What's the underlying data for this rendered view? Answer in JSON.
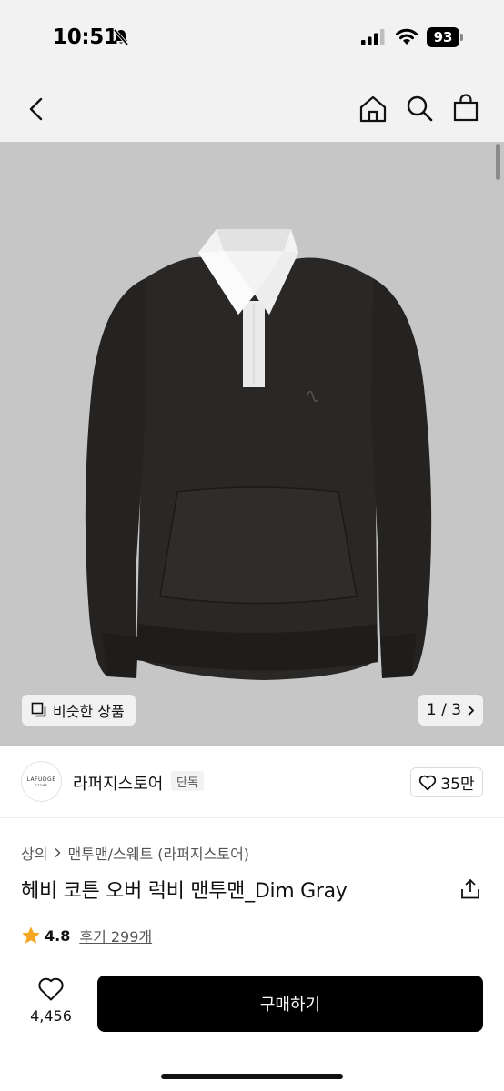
{
  "status_bar": {
    "time": "10:51",
    "battery": "93"
  },
  "nav": {
    "back_icon": "chevron-left-icon",
    "home_icon": "home-icon",
    "search_icon": "search-icon",
    "bag_icon": "shopping-bag-icon"
  },
  "gallery": {
    "similar_label": "비슷한 상품",
    "pager": "1 / 3",
    "background": "#c6c6c6"
  },
  "store": {
    "logo_text": "LAFUDGE",
    "logo_sub": "STORE",
    "name": "라퍼지스토어",
    "badge": "단독",
    "likes": "35만"
  },
  "breadcrumb": {
    "category": "상의",
    "subcategory": "맨투맨/스웨트 (라퍼지스토어)"
  },
  "product": {
    "title": "헤비 코튼 오버 럭비 맨투맨_Dim Gray"
  },
  "rating": {
    "value": "4.8",
    "reviews": "후기 299개",
    "star_color": "#f5a623"
  },
  "bottom_bar": {
    "wish_count": "4,456",
    "buy_label": "구매하기"
  }
}
